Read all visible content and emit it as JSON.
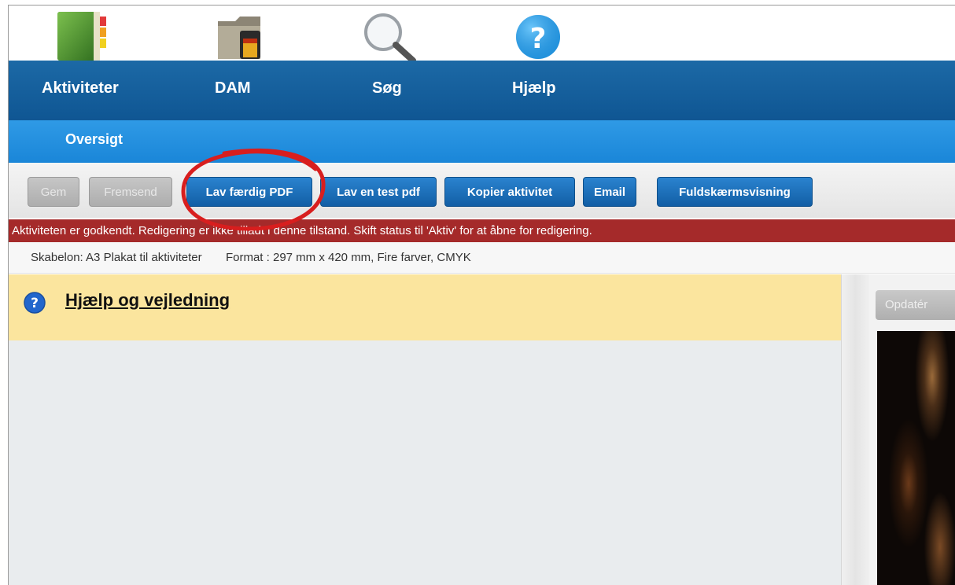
{
  "nav": {
    "tabs": [
      {
        "label": "Aktiviteter",
        "icon": "address-book-icon"
      },
      {
        "label": "DAM",
        "icon": "folder-film-icon"
      },
      {
        "label": "Søg",
        "icon": "magnifier-icon"
      },
      {
        "label": "Hjælp",
        "icon": "help-icon"
      }
    ]
  },
  "subnav": {
    "active_tab": "Oversigt"
  },
  "toolbar": {
    "buttons": [
      {
        "label": "Gem",
        "state": "disabled"
      },
      {
        "label": "Fremsend",
        "state": "disabled"
      },
      {
        "label": "Lav færdig PDF",
        "state": "enabled"
      },
      {
        "label": "Lav en test pdf",
        "state": "enabled"
      },
      {
        "label": "Kopier aktivitet",
        "state": "enabled"
      },
      {
        "label": "Email",
        "state": "enabled"
      },
      {
        "label": "Fuldskærmsvisning",
        "state": "enabled"
      }
    ]
  },
  "alert": {
    "text": "Aktiviteten er godkendt. Redigering er ikke tilladt i denne tilstand. Skift status til 'Aktiv' for at åbne for redigering."
  },
  "info": {
    "template_text": "Skabelon: A3 Plakat til aktiviteter",
    "format_text": "Format : 297 mm x 420 mm, Fire farver, CMYK"
  },
  "help": {
    "title": "Hjælp og vejledning"
  },
  "preview": {
    "update_label": "Opdatér"
  },
  "colors": {
    "main_nav": "#1461a0",
    "sub_nav": "#2592e0",
    "button_blue": "#1d72be",
    "alert_red": "#a52a2a",
    "help_bar": "#fbe59e",
    "annotation_red": "#d81e1e"
  }
}
